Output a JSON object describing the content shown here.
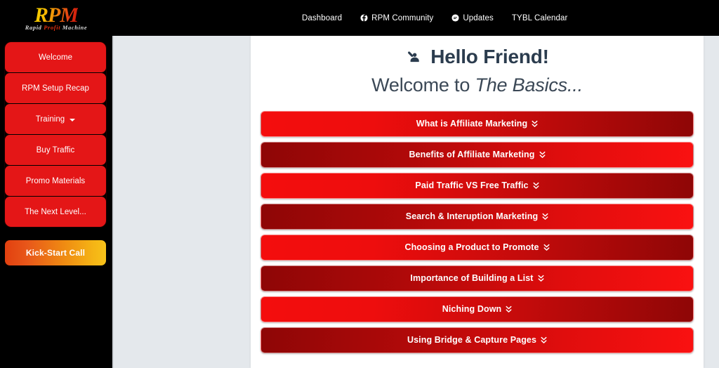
{
  "brand": {
    "logo_text": "RPM",
    "logo_tagline_prefix": "Rapid ",
    "logo_tagline_accent": "Profit",
    "logo_tagline_suffix": " Machine"
  },
  "topnav": {
    "items": [
      {
        "label": "Dashboard",
        "icon": ""
      },
      {
        "label": "RPM Community",
        "icon": "facebook-icon"
      },
      {
        "label": "Updates",
        "icon": "comment-icon"
      },
      {
        "label": "TYBL Calendar",
        "icon": ""
      }
    ]
  },
  "sidebar": {
    "items": [
      {
        "label": "Welcome",
        "has_caret": false
      },
      {
        "label": "RPM Setup Recap",
        "has_caret": false
      },
      {
        "label": "Training",
        "has_caret": true
      },
      {
        "label": "Buy Traffic",
        "has_caret": false
      },
      {
        "label": "Promo Materials",
        "has_caret": false
      },
      {
        "label": "The Next Level...",
        "has_caret": false
      }
    ],
    "cta_label": "Kick-Start Call"
  },
  "main": {
    "hello_heading": "Hello Friend!",
    "hello_icon": "person-raising-hand-icon",
    "welcome_prefix": "Welcome to ",
    "welcome_emphasis": "The Basics...",
    "accordion_icon": "chevron-double-down-icon",
    "accordion": [
      {
        "label": "What is Affiliate Marketing"
      },
      {
        "label": "Benefits of Affiliate Marketing"
      },
      {
        "label": "Paid Traffic VS Free Traffic"
      },
      {
        "label": "Search & Interuption Marketing"
      },
      {
        "label": "Choosing a Product to Promote"
      },
      {
        "label": "Importance of Building a List"
      },
      {
        "label": "Niching Down"
      },
      {
        "label": "Using Bridge & Capture Pages"
      }
    ]
  },
  "colors": {
    "header_bg": "#000000",
    "sidebar_bg": "#000000",
    "sidebar_item": "#e41617",
    "cta_gradient_start": "#e2400f",
    "cta_gradient_end": "#f7c21a",
    "page_bg": "#e4e8ec",
    "card_bg": "#ffffff",
    "heading_text": "#2b3c4e",
    "accordion_bright": "#f40d0d",
    "accordion_dark": "#8e0606"
  }
}
